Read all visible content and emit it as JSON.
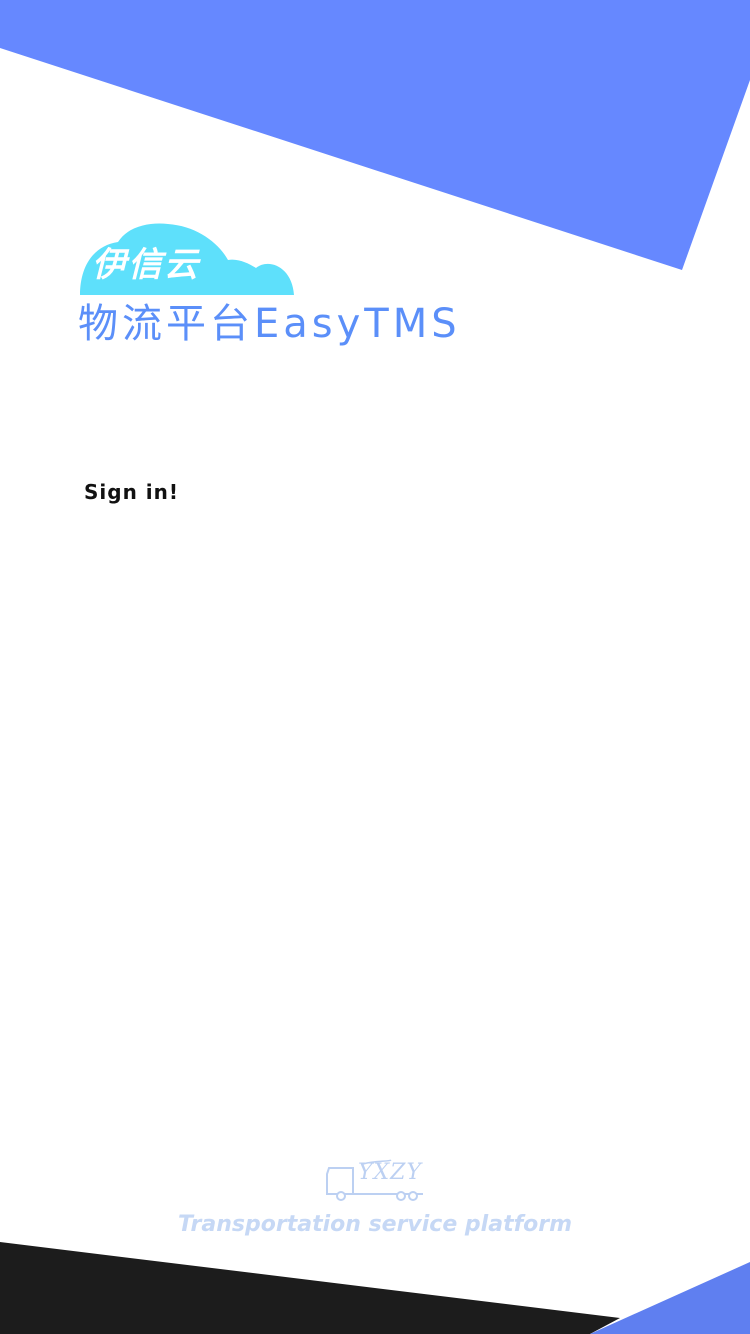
{
  "logo": {
    "cloud_text": "伊信云",
    "icon": "cloud-icon"
  },
  "app": {
    "title": "物流平台EasyTMS"
  },
  "signin": {
    "heading": "Sign in!"
  },
  "footer": {
    "logo_text": "YXZY",
    "logo_icon": "truck-icon",
    "tagline": "Transportation service platform"
  },
  "colors": {
    "accent_blue": "#6688ff",
    "cloud_cyan": "#5ee0fb",
    "title_blue": "#5b8ff9",
    "footer_dark": "#1c1c1c",
    "footer_blue": "#5f7ff0",
    "footer_text": "#c6d8f5"
  }
}
